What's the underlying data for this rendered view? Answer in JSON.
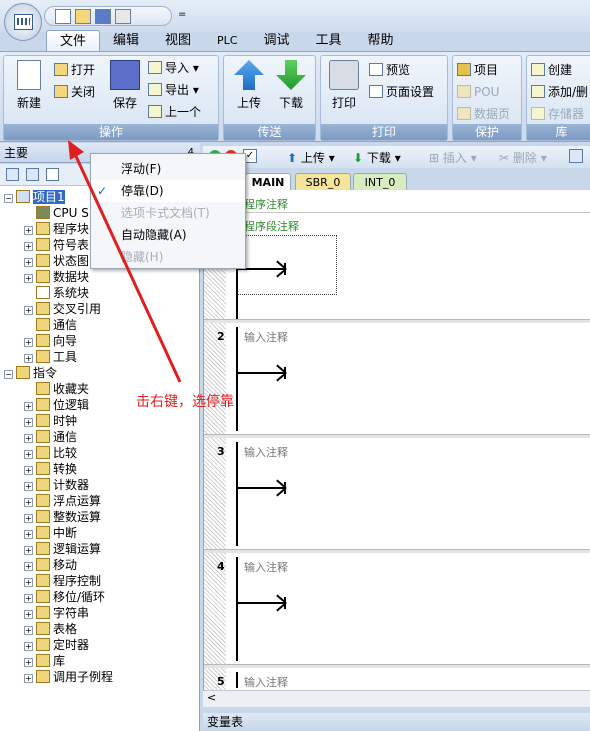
{
  "quick_access": {
    "dropdown": "="
  },
  "ribbon_tabs": [
    "文件",
    "编辑",
    "视图",
    "PLC",
    "调试",
    "工具",
    "帮助"
  ],
  "ribbon_groups": {
    "operate": {
      "label": "操作",
      "new": "新建",
      "open": "打开",
      "close": "关闭",
      "save": "保存",
      "import": "导入",
      "export": "导出",
      "prev": "上一个"
    },
    "transfer": {
      "label": "传送",
      "upload": "上传",
      "download": "下载"
    },
    "print": {
      "label": "打印",
      "print": "打印",
      "preview": "预览",
      "page_setup": "页面设置"
    },
    "protect": {
      "label": "保护",
      "project": "项目",
      "pou": "POU",
      "data_page": "数据页"
    },
    "library": {
      "label": "库",
      "create": "创建",
      "add": "添加/删",
      "storage": "存储器"
    }
  },
  "left_panel": {
    "title": "主要",
    "pin": "4"
  },
  "tree": {
    "project": "项目1",
    "project_items": [
      "CPU S",
      "程序块",
      "符号表",
      "状态图",
      "数据块",
      "系统块",
      "交叉引用",
      "通信",
      "向导",
      "工具"
    ],
    "instructions": "指令",
    "instruction_items": [
      "收藏夹",
      "位逻辑",
      "时钟",
      "通信",
      "比较",
      "转换",
      "计数器",
      "浮点运算",
      "整数运算",
      "中断",
      "逻辑运算",
      "移动",
      "程序控制",
      "移位/循环",
      "字符串",
      "表格",
      "定时器",
      "库",
      "调用子例程"
    ]
  },
  "editor_toolbar": {
    "upload": "上传",
    "download": "下载",
    "insert": "插入",
    "delete": "删除"
  },
  "editor_tabs": [
    "MAIN",
    "SBR_0",
    "INT_0"
  ],
  "editor": {
    "program_comment": "程序注释",
    "network1_comment": "程序段注释",
    "networks": [
      {
        "num": "2",
        "comment": "输入注释"
      },
      {
        "num": "3",
        "comment": "输入注释"
      },
      {
        "num": "4",
        "comment": "输入注释"
      },
      {
        "num": "5",
        "comment": "输入注释"
      }
    ]
  },
  "bottom_panel": {
    "title": "变量表"
  },
  "context_menu": {
    "items": [
      {
        "label": "浮动(F)",
        "checked": false,
        "disabled": false
      },
      {
        "label": "停靠(D)",
        "checked": true,
        "disabled": false
      },
      {
        "label": "选项卡式文档(T)",
        "checked": false,
        "disabled": true
      },
      {
        "label": "自动隐藏(A)",
        "checked": false,
        "disabled": false
      },
      {
        "label": "隐藏(H)",
        "checked": false,
        "disabled": true
      }
    ]
  },
  "annotation": {
    "text": "击右键，选停靠",
    "color": "#e02020"
  }
}
